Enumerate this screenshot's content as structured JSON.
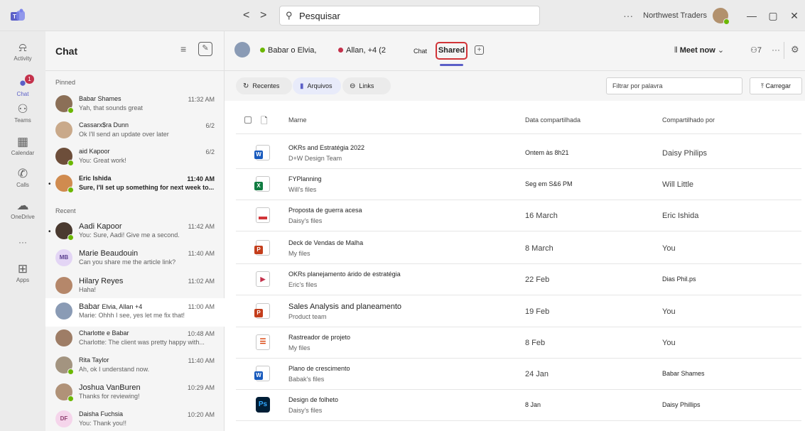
{
  "titlebar": {
    "back_label": "<",
    "forward_label": ">",
    "search_placeholder": "Pesquisar",
    "more": "···",
    "org_name": "Northwest Traders",
    "minimize": "—",
    "maximize": "▢",
    "close": "✕"
  },
  "rail": {
    "items": [
      {
        "label": "Activity",
        "icon": "bell-icon",
        "glyph": "🔔"
      },
      {
        "label": "Chat",
        "icon": "chat-icon",
        "glyph": "💬",
        "badge": "1"
      },
      {
        "label": "Teams",
        "icon": "teams-icon",
        "glyph": "👥"
      },
      {
        "label": "Calendar",
        "icon": "calendar-icon",
        "glyph": "📅"
      },
      {
        "label": "Calls",
        "icon": "phone-icon",
        "glyph": "✆"
      },
      {
        "label": "OneDrive",
        "icon": "cloud-icon",
        "glyph": "☁"
      },
      {
        "label": "",
        "icon": "more-icon",
        "glyph": "···"
      },
      {
        "label": "Apps",
        "icon": "apps-icon",
        "glyph": "⊞"
      }
    ]
  },
  "chatpanel": {
    "title": "Chat",
    "filter_glyph": "≡",
    "new_chat_glyph": "✎",
    "pinned_label": "Pinned",
    "recent_label": "Recent",
    "pinned": [
      {
        "name": "Babar Shames",
        "time": "11:32 AM",
        "preview": "Yah, that sounds great"
      },
      {
        "name": "Cassarx$ra Dunn",
        "time": "6/2",
        "preview": "Ok I'll send an update over later"
      },
      {
        "name": "aid Kapoor",
        "time": "6/2",
        "preview": "You: Great work!"
      },
      {
        "name": "Eric Ishida",
        "time": "11:40 AM",
        "preview": "Sure, I'll set up something for next week to..."
      }
    ],
    "recent": [
      {
        "name": "Aadi Kapoor",
        "time": "11:42 AM",
        "preview": "You: Sure, Aadi! Give me a second."
      },
      {
        "name": "Marie Beaudouin",
        "time": "11:40 AM",
        "preview": "Can you share me the article link?",
        "initials": "MB"
      },
      {
        "name": "Hilary Reyes",
        "time": "11:02 AM",
        "preview": "Haha!"
      },
      {
        "name": "Babar",
        "name_extra": "Elvia, Allan +4",
        "time": "11:00 AM",
        "preview": "Marie: Ohhh I see, yes let me fix that!"
      },
      {
        "name": "Charlotte e Babar",
        "time": "10:48 AM",
        "preview": "Charlotte: The client was pretty happy with..."
      },
      {
        "name": "Rita Taylor",
        "time": "11:40 AM",
        "preview": "Ah, ok I understand now."
      },
      {
        "name": "Joshua VanBuren",
        "time": "10:29 AM",
        "preview": "Thanks for reviewing!"
      },
      {
        "name": "Daisha Fuchsia",
        "time": "10:20 AM",
        "preview": "You: Thank you!!",
        "initials": "DF"
      }
    ]
  },
  "main": {
    "header": {
      "participant_1": "Babar o Elvia,",
      "participant_2": "Allan, +4 (2",
      "tab_chat": "Chat",
      "tab_shared": "Shared",
      "add_tab": "+",
      "meet_now": "Meet now",
      "participants_count": "7",
      "more": "···",
      "accent_color": "#5b5fc7",
      "highlight_color": "#d13438"
    },
    "toolbar": {
      "recent": "Recentes",
      "files": "Arquivos",
      "links": "Links",
      "filter_placeholder": "Filtrar por palavra",
      "upload": "Carregar"
    },
    "columns": {
      "name": "Marne",
      "date": "Data compartilhada",
      "shared_by": "Compartilhado por"
    },
    "files": [
      {
        "name": "OKRs and Estratégia 2022",
        "location": "D+W Design Team",
        "date": "Ontem às 8h21",
        "by": "Daisy Philips",
        "icon": "word-icon",
        "type": "word"
      },
      {
        "name": "FYPlanning",
        "location": "Will's files",
        "date": "Seg em S&6 PM",
        "by": "Will Little",
        "icon": "excel-icon",
        "type": "excel"
      },
      {
        "name": "Proposta de guerra acesa",
        "location": "Daisy's files",
        "date": "16 March",
        "by": "Eric Ishida",
        "icon": "pdf-icon",
        "type": "pdf"
      },
      {
        "name": "Deck de Vendas de Malha",
        "location": "My files",
        "date": "8 March",
        "by": "You",
        "icon": "powerpoint-icon",
        "type": "ppt"
      },
      {
        "name": "OKRs planejamento árido de estratégia",
        "location": "Eric's files",
        "date": "22 Feb",
        "by": "Dias Phil.ps",
        "icon": "video-icon",
        "type": "video"
      },
      {
        "name": "Sales Analysis and planeamento",
        "location": "Product team",
        "date": "19 Feb",
        "by": "You",
        "icon": "powerpoint-icon",
        "type": "ppt"
      },
      {
        "name": "Rastreador de projeto",
        "location": "My files",
        "date": "8 Feb",
        "by": "You",
        "icon": "list-icon",
        "type": "list"
      },
      {
        "name": "Plano de crescimento",
        "location": "Babak's files",
        "date": "24 Jan",
        "by": "Babar Shames",
        "icon": "word-icon",
        "type": "word"
      },
      {
        "name": "Design de folheto",
        "location": "Daisy's files",
        "date": "8 Jan",
        "by": "Daisy Phillips",
        "icon": "photoshop-icon",
        "type": "ps"
      }
    ]
  }
}
